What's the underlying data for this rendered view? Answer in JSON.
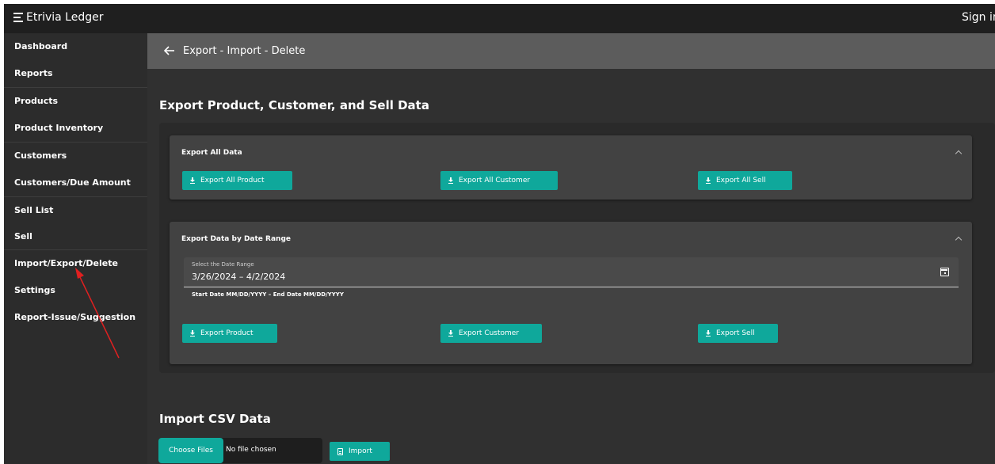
{
  "app": {
    "title": "Etrivia Ledger",
    "signin": "Sign in"
  },
  "sidebar": {
    "items": [
      {
        "label": "Dashboard"
      },
      {
        "label": "Reports"
      },
      {
        "label": "Products"
      },
      {
        "label": "Product Inventory"
      },
      {
        "label": "Customers"
      },
      {
        "label": "Customers/Due Amount"
      },
      {
        "label": "Sell List"
      },
      {
        "label": "Sell"
      },
      {
        "label": "Import/Export/Delete"
      },
      {
        "label": "Settings"
      },
      {
        "label": "Report-Issue/Suggestion"
      }
    ]
  },
  "page": {
    "title": "Export - Import - Delete"
  },
  "export": {
    "heading": "Export Product, Customer, and Sell Data",
    "all_panel": {
      "title": "Export All Data",
      "buttons": [
        "Export All Product",
        "Export All Customer",
        "Export All Sell"
      ]
    },
    "range_panel": {
      "title": "Export Data by Date Range",
      "field_label": "Select the Date Range",
      "field_value": "3/26/2024 – 4/2/2024",
      "hint": "Start Date MM/DD/YYYY – End Date MM/DD/YYYY",
      "buttons": [
        "Export Product",
        "Export Customer",
        "Export Sell"
      ]
    }
  },
  "import": {
    "heading": "Import CSV Data",
    "choose_label": "Choose Files",
    "no_file": "No file chosen",
    "import_label": "Import"
  },
  "colors": {
    "accent": "#0fa89b",
    "topbar": "#1f1f1f",
    "sidebar": "#2c2c2c",
    "main": "#303030",
    "panel": "#424242",
    "annotation_arrow": "#e02020"
  },
  "icons": [
    "menu-icon",
    "back-arrow-icon",
    "chevron-up-icon",
    "download-icon",
    "calendar-icon",
    "file-icon"
  ]
}
